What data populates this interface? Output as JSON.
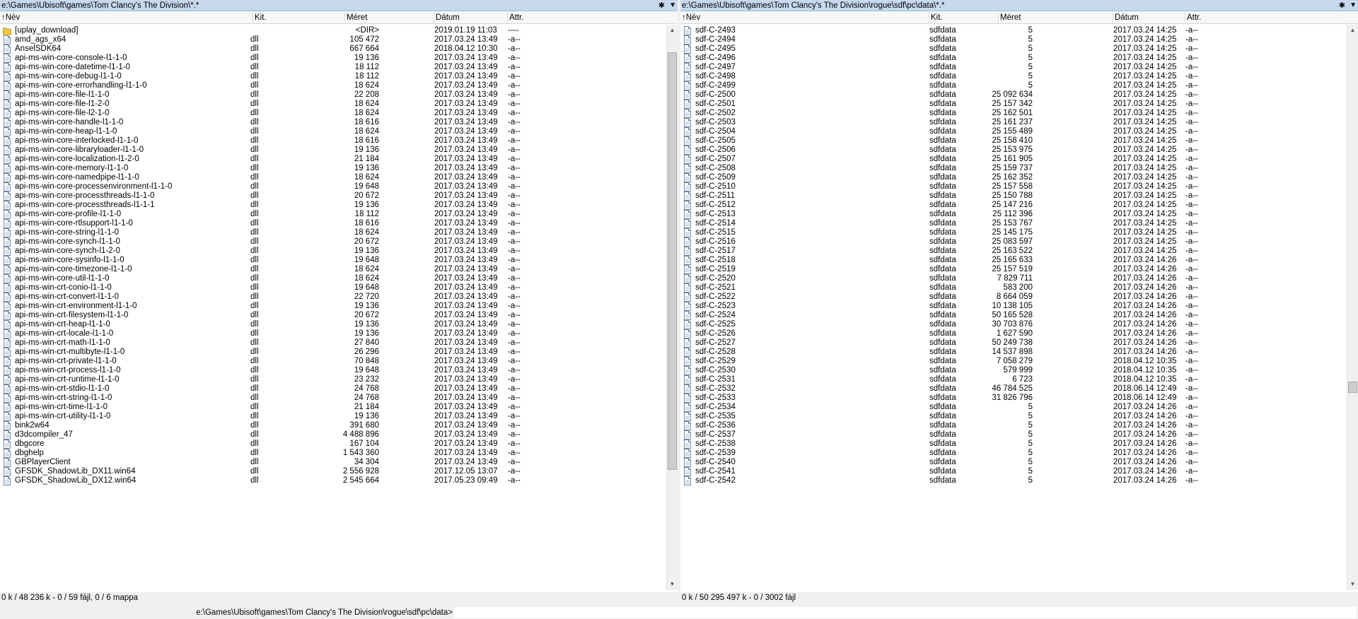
{
  "left_panel": {
    "path": "e:\\Games\\Ubisoft\\games\\Tom Clancy's The Division\\*.*",
    "columns": {
      "name": "Név",
      "ext": "Kit.",
      "size": "Méret",
      "date": "Dátum",
      "attr": "Attr."
    },
    "rows": [
      {
        "name": "[uplay_download]",
        "ext": "",
        "size": "<DIR>",
        "date": "2019.01.19 11:03",
        "attr": "----",
        "icon": "folder-icon"
      },
      {
        "name": "amd_ags_x64",
        "ext": "dll",
        "size": "105 472",
        "date": "2017.03.24 13:49",
        "attr": "-a--",
        "icon": "file-icon"
      },
      {
        "name": "AnselSDK64",
        "ext": "dll",
        "size": "667 664",
        "date": "2018.04.12 10:30",
        "attr": "-a--",
        "icon": "file-icon"
      },
      {
        "name": "api-ms-win-core-console-l1-1-0",
        "ext": "dll",
        "size": "19 136",
        "date": "2017.03.24 13:49",
        "attr": "-a--",
        "icon": "file-icon"
      },
      {
        "name": "api-ms-win-core-datetime-l1-1-0",
        "ext": "dll",
        "size": "18 112",
        "date": "2017.03.24 13:49",
        "attr": "-a--",
        "icon": "file-icon"
      },
      {
        "name": "api-ms-win-core-debug-l1-1-0",
        "ext": "dll",
        "size": "18 112",
        "date": "2017.03.24 13:49",
        "attr": "-a--",
        "icon": "file-icon"
      },
      {
        "name": "api-ms-win-core-errorhandling-l1-1-0",
        "ext": "dll",
        "size": "18 624",
        "date": "2017.03.24 13:49",
        "attr": "-a--",
        "icon": "file-icon"
      },
      {
        "name": "api-ms-win-core-file-l1-1-0",
        "ext": "dll",
        "size": "22 208",
        "date": "2017.03.24 13:49",
        "attr": "-a--",
        "icon": "file-icon"
      },
      {
        "name": "api-ms-win-core-file-l1-2-0",
        "ext": "dll",
        "size": "18 624",
        "date": "2017.03.24 13:49",
        "attr": "-a--",
        "icon": "file-icon"
      },
      {
        "name": "api-ms-win-core-file-l2-1-0",
        "ext": "dll",
        "size": "18 624",
        "date": "2017.03.24 13:49",
        "attr": "-a--",
        "icon": "file-icon"
      },
      {
        "name": "api-ms-win-core-handle-l1-1-0",
        "ext": "dll",
        "size": "18 616",
        "date": "2017.03.24 13:49",
        "attr": "-a--",
        "icon": "file-icon"
      },
      {
        "name": "api-ms-win-core-heap-l1-1-0",
        "ext": "dll",
        "size": "18 624",
        "date": "2017.03.24 13:49",
        "attr": "-a--",
        "icon": "file-icon"
      },
      {
        "name": "api-ms-win-core-interlocked-l1-1-0",
        "ext": "dll",
        "size": "18 616",
        "date": "2017.03.24 13:49",
        "attr": "-a--",
        "icon": "file-icon"
      },
      {
        "name": "api-ms-win-core-libraryloader-l1-1-0",
        "ext": "dll",
        "size": "19 136",
        "date": "2017.03.24 13:49",
        "attr": "-a--",
        "icon": "file-icon"
      },
      {
        "name": "api-ms-win-core-localization-l1-2-0",
        "ext": "dll",
        "size": "21 184",
        "date": "2017.03.24 13:49",
        "attr": "-a--",
        "icon": "file-icon"
      },
      {
        "name": "api-ms-win-core-memory-l1-1-0",
        "ext": "dll",
        "size": "19 136",
        "date": "2017.03.24 13:49",
        "attr": "-a--",
        "icon": "file-icon"
      },
      {
        "name": "api-ms-win-core-namedpipe-l1-1-0",
        "ext": "dll",
        "size": "18 624",
        "date": "2017.03.24 13:49",
        "attr": "-a--",
        "icon": "file-icon"
      },
      {
        "name": "api-ms-win-core-processenvironment-l1-1-0",
        "ext": "dll",
        "size": "19 648",
        "date": "2017.03.24 13:49",
        "attr": "-a--",
        "icon": "file-icon"
      },
      {
        "name": "api-ms-win-core-processthreads-l1-1-0",
        "ext": "dll",
        "size": "20 672",
        "date": "2017.03.24 13:49",
        "attr": "-a--",
        "icon": "file-icon"
      },
      {
        "name": "api-ms-win-core-processthreads-l1-1-1",
        "ext": "dll",
        "size": "19 136",
        "date": "2017.03.24 13:49",
        "attr": "-a--",
        "icon": "file-icon"
      },
      {
        "name": "api-ms-win-core-profile-l1-1-0",
        "ext": "dll",
        "size": "18 112",
        "date": "2017.03.24 13:49",
        "attr": "-a--",
        "icon": "file-icon"
      },
      {
        "name": "api-ms-win-core-rtlsupport-l1-1-0",
        "ext": "dll",
        "size": "18 616",
        "date": "2017.03.24 13:49",
        "attr": "-a--",
        "icon": "file-icon"
      },
      {
        "name": "api-ms-win-core-string-l1-1-0",
        "ext": "dll",
        "size": "18 624",
        "date": "2017.03.24 13:49",
        "attr": "-a--",
        "icon": "file-icon"
      },
      {
        "name": "api-ms-win-core-synch-l1-1-0",
        "ext": "dll",
        "size": "20 672",
        "date": "2017.03.24 13:49",
        "attr": "-a--",
        "icon": "file-icon"
      },
      {
        "name": "api-ms-win-core-synch-l1-2-0",
        "ext": "dll",
        "size": "19 136",
        "date": "2017.03.24 13:49",
        "attr": "-a--",
        "icon": "file-icon"
      },
      {
        "name": "api-ms-win-core-sysinfo-l1-1-0",
        "ext": "dll",
        "size": "19 648",
        "date": "2017.03.24 13:49",
        "attr": "-a--",
        "icon": "file-icon"
      },
      {
        "name": "api-ms-win-core-timezone-l1-1-0",
        "ext": "dll",
        "size": "18 624",
        "date": "2017.03.24 13:49",
        "attr": "-a--",
        "icon": "file-icon"
      },
      {
        "name": "api-ms-win-core-util-l1-1-0",
        "ext": "dll",
        "size": "18 624",
        "date": "2017.03.24 13:49",
        "attr": "-a--",
        "icon": "file-icon"
      },
      {
        "name": "api-ms-win-crt-conio-l1-1-0",
        "ext": "dll",
        "size": "19 648",
        "date": "2017.03.24 13:49",
        "attr": "-a--",
        "icon": "file-icon"
      },
      {
        "name": "api-ms-win-crt-convert-l1-1-0",
        "ext": "dll",
        "size": "22 720",
        "date": "2017.03.24 13:49",
        "attr": "-a--",
        "icon": "file-icon"
      },
      {
        "name": "api-ms-win-crt-environment-l1-1-0",
        "ext": "dll",
        "size": "19 136",
        "date": "2017.03.24 13:49",
        "attr": "-a--",
        "icon": "file-icon"
      },
      {
        "name": "api-ms-win-crt-filesystem-l1-1-0",
        "ext": "dll",
        "size": "20 672",
        "date": "2017.03.24 13:49",
        "attr": "-a--",
        "icon": "file-icon"
      },
      {
        "name": "api-ms-win-crt-heap-l1-1-0",
        "ext": "dll",
        "size": "19 136",
        "date": "2017.03.24 13:49",
        "attr": "-a--",
        "icon": "file-icon"
      },
      {
        "name": "api-ms-win-crt-locale-l1-1-0",
        "ext": "dll",
        "size": "19 136",
        "date": "2017.03.24 13:49",
        "attr": "-a--",
        "icon": "file-icon"
      },
      {
        "name": "api-ms-win-crt-math-l1-1-0",
        "ext": "dll",
        "size": "27 840",
        "date": "2017.03.24 13:49",
        "attr": "-a--",
        "icon": "file-icon"
      },
      {
        "name": "api-ms-win-crt-multibyte-l1-1-0",
        "ext": "dll",
        "size": "26 296",
        "date": "2017.03.24 13:49",
        "attr": "-a--",
        "icon": "file-icon"
      },
      {
        "name": "api-ms-win-crt-private-l1-1-0",
        "ext": "dll",
        "size": "70 848",
        "date": "2017.03.24 13:49",
        "attr": "-a--",
        "icon": "file-icon"
      },
      {
        "name": "api-ms-win-crt-process-l1-1-0",
        "ext": "dll",
        "size": "19 648",
        "date": "2017.03.24 13:49",
        "attr": "-a--",
        "icon": "file-icon"
      },
      {
        "name": "api-ms-win-crt-runtime-l1-1-0",
        "ext": "dll",
        "size": "23 232",
        "date": "2017.03.24 13:49",
        "attr": "-a--",
        "icon": "file-icon"
      },
      {
        "name": "api-ms-win-crt-stdio-l1-1-0",
        "ext": "dll",
        "size": "24 768",
        "date": "2017.03.24 13:49",
        "attr": "-a--",
        "icon": "file-icon"
      },
      {
        "name": "api-ms-win-crt-string-l1-1-0",
        "ext": "dll",
        "size": "24 768",
        "date": "2017.03.24 13:49",
        "attr": "-a--",
        "icon": "file-icon"
      },
      {
        "name": "api-ms-win-crt-time-l1-1-0",
        "ext": "dll",
        "size": "21 184",
        "date": "2017.03.24 13:49",
        "attr": "-a--",
        "icon": "file-icon"
      },
      {
        "name": "api-ms-win-crt-utility-l1-1-0",
        "ext": "dll",
        "size": "19 136",
        "date": "2017.03.24 13:49",
        "attr": "-a--",
        "icon": "file-icon"
      },
      {
        "name": "bink2w64",
        "ext": "dll",
        "size": "391 680",
        "date": "2017.03.24 13:49",
        "attr": "-a--",
        "icon": "file-icon"
      },
      {
        "name": "d3dcompiler_47",
        "ext": "dll",
        "size": "4 488 896",
        "date": "2017.03.24 13:49",
        "attr": "-a--",
        "icon": "file-icon"
      },
      {
        "name": "dbgcore",
        "ext": "dll",
        "size": "167 104",
        "date": "2017.03.24 13:49",
        "attr": "-a--",
        "icon": "file-icon"
      },
      {
        "name": "dbghelp",
        "ext": "dll",
        "size": "1 543 360",
        "date": "2017.03.24 13:49",
        "attr": "-a--",
        "icon": "file-icon"
      },
      {
        "name": "GBPlayerClient",
        "ext": "dll",
        "size": "34 304",
        "date": "2017.03.24 13:49",
        "attr": "-a--",
        "icon": "file-icon"
      },
      {
        "name": "GFSDK_ShadowLib_DX11.win64",
        "ext": "dll",
        "size": "2 556 928",
        "date": "2017.12.05 13:07",
        "attr": "-a--",
        "icon": "file-icon"
      },
      {
        "name": "GFSDK_ShadowLib_DX12.win64",
        "ext": "dll",
        "size": "2 545 664",
        "date": "2017.05.23 09:49",
        "attr": "-a--",
        "icon": "file-icon"
      }
    ],
    "status": "0 k / 48 236 k - 0 / 59 fájl, 0 / 6 mappa",
    "scroll_position": 0.13,
    "scroll_visible_fraction": 0.77
  },
  "right_panel": {
    "path": "e:\\Games\\Ubisoft\\games\\Tom Clancy's The Division\\rogue\\sdf\\pc\\data\\*.*",
    "columns": {
      "name": "Név",
      "ext": "Kit.",
      "size": "Méret",
      "date": "Dátum",
      "attr": "Attr."
    },
    "rows": [
      {
        "name": "sdf-C-2493",
        "ext": "sdfdata",
        "size": "5",
        "date": "2017.03.24 14:25",
        "attr": "-a--"
      },
      {
        "name": "sdf-C-2494",
        "ext": "sdfdata",
        "size": "5",
        "date": "2017.03.24 14:25",
        "attr": "-a--"
      },
      {
        "name": "sdf-C-2495",
        "ext": "sdfdata",
        "size": "5",
        "date": "2017.03.24 14:25",
        "attr": "-a--"
      },
      {
        "name": "sdf-C-2496",
        "ext": "sdfdata",
        "size": "5",
        "date": "2017.03.24 14:25",
        "attr": "-a--"
      },
      {
        "name": "sdf-C-2497",
        "ext": "sdfdata",
        "size": "5",
        "date": "2017.03.24 14:25",
        "attr": "-a--"
      },
      {
        "name": "sdf-C-2498",
        "ext": "sdfdata",
        "size": "5",
        "date": "2017.03.24 14:25",
        "attr": "-a--"
      },
      {
        "name": "sdf-C-2499",
        "ext": "sdfdata",
        "size": "5",
        "date": "2017.03.24 14:25",
        "attr": "-a--"
      },
      {
        "name": "sdf-C-2500",
        "ext": "sdfdata",
        "size": "25 092 634",
        "date": "2017.03.24 14:25",
        "attr": "-a--"
      },
      {
        "name": "sdf-C-2501",
        "ext": "sdfdata",
        "size": "25 157 342",
        "date": "2017.03.24 14:25",
        "attr": "-a--"
      },
      {
        "name": "sdf-C-2502",
        "ext": "sdfdata",
        "size": "25 162 501",
        "date": "2017.03.24 14:25",
        "attr": "-a--"
      },
      {
        "name": "sdf-C-2503",
        "ext": "sdfdata",
        "size": "25 161 237",
        "date": "2017.03.24 14:25",
        "attr": "-a--"
      },
      {
        "name": "sdf-C-2504",
        "ext": "sdfdata",
        "size": "25 155 489",
        "date": "2017.03.24 14:25",
        "attr": "-a--"
      },
      {
        "name": "sdf-C-2505",
        "ext": "sdfdata",
        "size": "25 158 410",
        "date": "2017.03.24 14:25",
        "attr": "-a--"
      },
      {
        "name": "sdf-C-2506",
        "ext": "sdfdata",
        "size": "25 153 975",
        "date": "2017.03.24 14:25",
        "attr": "-a--"
      },
      {
        "name": "sdf-C-2507",
        "ext": "sdfdata",
        "size": "25 161 905",
        "date": "2017.03.24 14:25",
        "attr": "-a--"
      },
      {
        "name": "sdf-C-2508",
        "ext": "sdfdata",
        "size": "25 159 737",
        "date": "2017.03.24 14:25",
        "attr": "-a--"
      },
      {
        "name": "sdf-C-2509",
        "ext": "sdfdata",
        "size": "25 162 352",
        "date": "2017.03.24 14:25",
        "attr": "-a--"
      },
      {
        "name": "sdf-C-2510",
        "ext": "sdfdata",
        "size": "25 157 558",
        "date": "2017.03.24 14:25",
        "attr": "-a--"
      },
      {
        "name": "sdf-C-2511",
        "ext": "sdfdata",
        "size": "25 150 788",
        "date": "2017.03.24 14:25",
        "attr": "-a--"
      },
      {
        "name": "sdf-C-2512",
        "ext": "sdfdata",
        "size": "25 147 216",
        "date": "2017.03.24 14:25",
        "attr": "-a--"
      },
      {
        "name": "sdf-C-2513",
        "ext": "sdfdata",
        "size": "25 112 396",
        "date": "2017.03.24 14:25",
        "attr": "-a--"
      },
      {
        "name": "sdf-C-2514",
        "ext": "sdfdata",
        "size": "25 153 767",
        "date": "2017.03.24 14:25",
        "attr": "-a--"
      },
      {
        "name": "sdf-C-2515",
        "ext": "sdfdata",
        "size": "25 145 175",
        "date": "2017.03.24 14:25",
        "attr": "-a--"
      },
      {
        "name": "sdf-C-2516",
        "ext": "sdfdata",
        "size": "25 083 597",
        "date": "2017.03.24 14:25",
        "attr": "-a--"
      },
      {
        "name": "sdf-C-2517",
        "ext": "sdfdata",
        "size": "25 163 522",
        "date": "2017.03.24 14:25",
        "attr": "-a--"
      },
      {
        "name": "sdf-C-2518",
        "ext": "sdfdata",
        "size": "25 165 633",
        "date": "2017.03.24 14:26",
        "attr": "-a--"
      },
      {
        "name": "sdf-C-2519",
        "ext": "sdfdata",
        "size": "25 157 519",
        "date": "2017.03.24 14:26",
        "attr": "-a--"
      },
      {
        "name": "sdf-C-2520",
        "ext": "sdfdata",
        "size": "7 829 711",
        "date": "2017.03.24 14:26",
        "attr": "-a--"
      },
      {
        "name": "sdf-C-2521",
        "ext": "sdfdata",
        "size": "583 200",
        "date": "2017.03.24 14:26",
        "attr": "-a--"
      },
      {
        "name": "sdf-C-2522",
        "ext": "sdfdata",
        "size": "8 664 059",
        "date": "2017.03.24 14:26",
        "attr": "-a--"
      },
      {
        "name": "sdf-C-2523",
        "ext": "sdfdata",
        "size": "10 138 105",
        "date": "2017.03.24 14:26",
        "attr": "-a--"
      },
      {
        "name": "sdf-C-2524",
        "ext": "sdfdata",
        "size": "50 165 528",
        "date": "2017.03.24 14:26",
        "attr": "-a--"
      },
      {
        "name": "sdf-C-2525",
        "ext": "sdfdata",
        "size": "30 703 876",
        "date": "2017.03.24 14:26",
        "attr": "-a--"
      },
      {
        "name": "sdf-C-2526",
        "ext": "sdfdata",
        "size": "1 627 590",
        "date": "2017.03.24 14:26",
        "attr": "-a--"
      },
      {
        "name": "sdf-C-2527",
        "ext": "sdfdata",
        "size": "50 249 738",
        "date": "2017.03.24 14:26",
        "attr": "-a--"
      },
      {
        "name": "sdf-C-2528",
        "ext": "sdfdata",
        "size": "14 537 898",
        "date": "2017.03.24 14:26",
        "attr": "-a--"
      },
      {
        "name": "sdf-C-2529",
        "ext": "sdfdata",
        "size": "7 058 279",
        "date": "2018.04.12 10:35",
        "attr": "-a--"
      },
      {
        "name": "sdf-C-2530",
        "ext": "sdfdata",
        "size": "579 999",
        "date": "2018.04.12 10:35",
        "attr": "-a--"
      },
      {
        "name": "sdf-C-2531",
        "ext": "sdfdata",
        "size": "6 723",
        "date": "2018.04.12 10:35",
        "attr": "-a--"
      },
      {
        "name": "sdf-C-2532",
        "ext": "sdfdata",
        "size": "46 784 525",
        "date": "2018.06.14 12:49",
        "attr": "-a--"
      },
      {
        "name": "sdf-C-2533",
        "ext": "sdfdata",
        "size": "31 826 796",
        "date": "2018.06.14 12:49",
        "attr": "-a--"
      },
      {
        "name": "sdf-C-2534",
        "ext": "sdfdata",
        "size": "5",
        "date": "2017.03.24 14:26",
        "attr": "-a--"
      },
      {
        "name": "sdf-C-2535",
        "ext": "sdfdata",
        "size": "5",
        "date": "2017.03.24 14:26",
        "attr": "-a--"
      },
      {
        "name": "sdf-C-2536",
        "ext": "sdfdata",
        "size": "5",
        "date": "2017.03.24 14:26",
        "attr": "-a--"
      },
      {
        "name": "sdf-C-2537",
        "ext": "sdfdata",
        "size": "5",
        "date": "2017.03.24 14:26",
        "attr": "-a--"
      },
      {
        "name": "sdf-C-2538",
        "ext": "sdfdata",
        "size": "5",
        "date": "2017.03.24 14:26",
        "attr": "-a--"
      },
      {
        "name": "sdf-C-2539",
        "ext": "sdfdata",
        "size": "5",
        "date": "2017.03.24 14:26",
        "attr": "-a--"
      },
      {
        "name": "sdf-C-2540",
        "ext": "sdfdata",
        "size": "5",
        "date": "2017.03.24 14:26",
        "attr": "-a--"
      },
      {
        "name": "sdf-C-2541",
        "ext": "sdfdata",
        "size": "5",
        "date": "2017.03.24 14:26",
        "attr": "-a--"
      },
      {
        "name": "sdf-C-2542",
        "ext": "sdfdata",
        "size": "5",
        "date": "2017.03.24 14:26",
        "attr": "-a--"
      }
    ],
    "status": "0 k / 50 295 497 k - 0 / 3002 fájl",
    "scroll_position": 0.65,
    "scroll_visible_fraction": 0.02
  },
  "toolbar_icons": {
    "star": "star-icon",
    "dropdown": "dropdown-arrow-icon",
    "sort": "sort-up-arrow-icon"
  },
  "command_line": {
    "prompt": "e:\\Games\\Ubisoft\\games\\Tom Clancy's The Division\\rogue\\sdf\\pc\\data>",
    "value": ""
  },
  "colors": {
    "path_bar_left": "#c8d8ec",
    "path_bar_right": "#c7d9ef",
    "folder": "#f4c542"
  }
}
